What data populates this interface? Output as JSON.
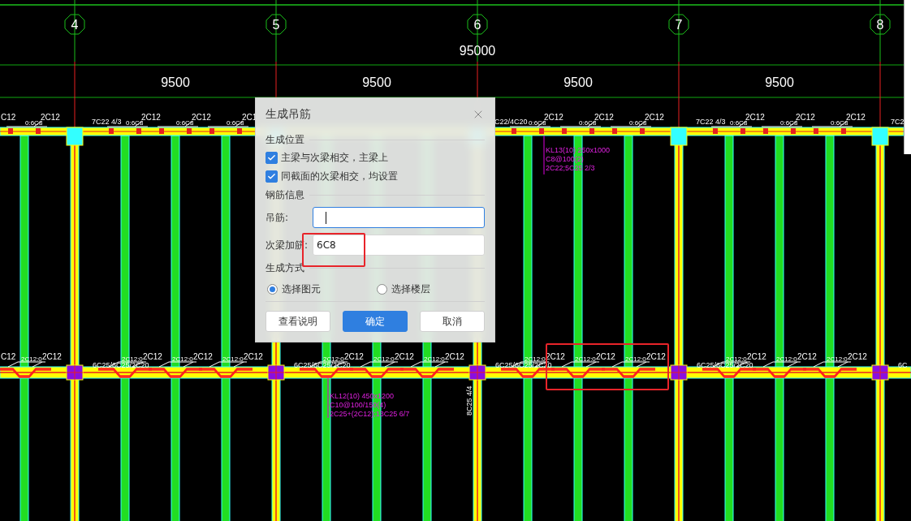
{
  "drawing": {
    "overall_dimension": "95000",
    "bay_dimensions": [
      "9500",
      "9500",
      "9500",
      "9500"
    ],
    "edge_labels": {
      "top": "C12",
      "bottom": "C12"
    },
    "axes": [
      {
        "label": "4",
        "top_beam_label": "7C22 4/3",
        "bottom_beam_label": "6C25/6C25/2C20"
      },
      {
        "label": "5",
        "bottom_beam_label": "6C25/6C25/2C20"
      },
      {
        "label": "6",
        "top_beam_label": "C22/4C20",
        "bottom_beam_label": "6C25/6C25/2C20",
        "side_label": "8C25 4/4"
      },
      {
        "label": "7",
        "top_beam_label": "7C22 4/3",
        "bottom_beam_label": "6C25/6C25/2C20"
      },
      {
        "label": "8",
        "top_beam_label": "7C2",
        "bottom_beam_label": "6C"
      }
    ],
    "secondary_beams": [
      {
        "top_stirrup": "0:6C8",
        "top_bar": "2C12",
        "bottom_stirrup": "2C12:0",
        "bottom_bar": "2C12"
      },
      {
        "top_stirrup": "0:6C8",
        "top_bar": "2C12",
        "bottom_stirrup": "2C12:0",
        "bottom_bar": "2C12"
      },
      {
        "top_stirrup": "0:6C8",
        "top_bar": "2C12",
        "bottom_stirrup": "2C12:0",
        "bottom_bar": "2C12"
      },
      {
        "top_stirrup": "0:6C8",
        "top_bar": "2C1",
        "bottom_stirrup": "2C12:0",
        "bottom_bar": "2C12"
      },
      {
        "bottom_stirrup": "2C12:0",
        "bottom_bar": "2C12",
        "bottom_note": [
          "KL12(10) 450x1200",
          "C10@100/150(4)",
          "2C25+(2C12);13C25 6/7"
        ]
      },
      {
        "bottom_stirrup": "2C12:0",
        "bottom_bar": "2C12"
      },
      {
        "bottom_stirrup": "2C12:0",
        "bottom_bar": "2C12"
      },
      {
        "top_stirrup": "0:6C8",
        "top_bar": "2C12",
        "bottom_stirrup": "2C12:0",
        "bottom_bar": "2C12",
        "top_note": [
          "KL13(10) 250x1000",
          "C8@100(2)",
          "2C22;5C25 2/3"
        ]
      },
      {
        "top_stirrup": "0:6C8",
        "top_bar": "2C12",
        "bottom_stirrup": "2C12:0",
        "bottom_bar": "2C12"
      },
      {
        "top_stirrup": "0:6C8",
        "top_bar": "2C12",
        "bottom_stirrup": "2C12:0",
        "bottom_bar": "2C12"
      },
      {
        "top_stirrup": "0:6C8",
        "top_bar": "2C12",
        "bottom_stirrup": "2C12:0",
        "bottom_bar": "2C12"
      },
      {
        "top_stirrup": "0:6C8",
        "top_bar": "2C12",
        "bottom_stirrup": "2C12:0",
        "bottom_bar": "2C12"
      },
      {
        "top_stirrup": "0:6C8",
        "top_bar": "2C12",
        "bottom_stirrup": "2C12:0",
        "bottom_bar": "2C12"
      }
    ]
  },
  "dialog": {
    "title": "生成吊筋",
    "sections": [
      {
        "title": "生成位置",
        "kind": "checkboxes",
        "items": [
          {
            "label": "主梁与次梁相交，主梁上",
            "checked": true
          },
          {
            "label": "同截面的次梁相交，均设置",
            "checked": true
          }
        ]
      },
      {
        "title": "钢筋信息",
        "kind": "fields",
        "items": [
          {
            "label": "吊筋:",
            "focused": true
          },
          {
            "label": "次梁加筋:",
            "value": "6C8",
            "highlighted": true
          }
        ]
      },
      {
        "title": "生成方式",
        "kind": "radios",
        "items": [
          {
            "label": "选择图元",
            "selected": true
          },
          {
            "label": "选择楼层",
            "selected": false
          }
        ]
      }
    ],
    "buttons": [
      {
        "label": "查看说明",
        "primary": false
      },
      {
        "label": "确定",
        "primary": true
      },
      {
        "label": "取消",
        "primary": false
      }
    ]
  }
}
